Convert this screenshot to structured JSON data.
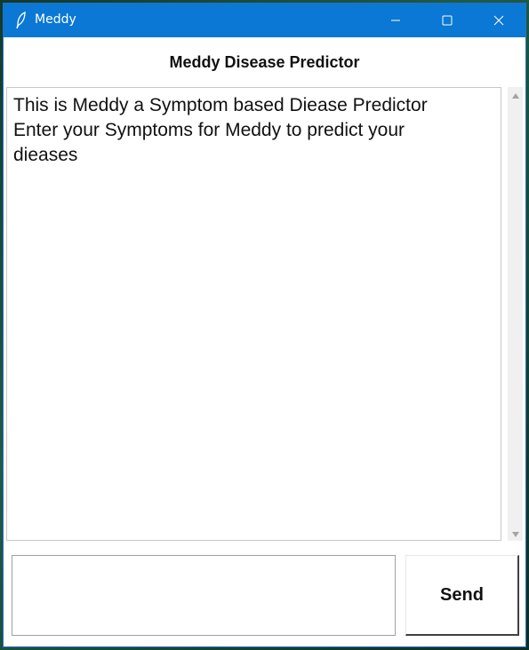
{
  "window": {
    "title": "Meddy",
    "icons": {
      "app": "feather-icon",
      "minimize": "minimize-icon",
      "maximize": "maximize-icon",
      "close": "close-icon"
    },
    "titlebar_color": "#0a78d4"
  },
  "header": {
    "title": "Meddy Disease Predictor"
  },
  "chat": {
    "text": "This is Meddy a Symptom based Diease Predictor\nEnter your Symptoms for Meddy to predict your\ndieases"
  },
  "input": {
    "value": "",
    "placeholder": ""
  },
  "send": {
    "label": "Send"
  }
}
